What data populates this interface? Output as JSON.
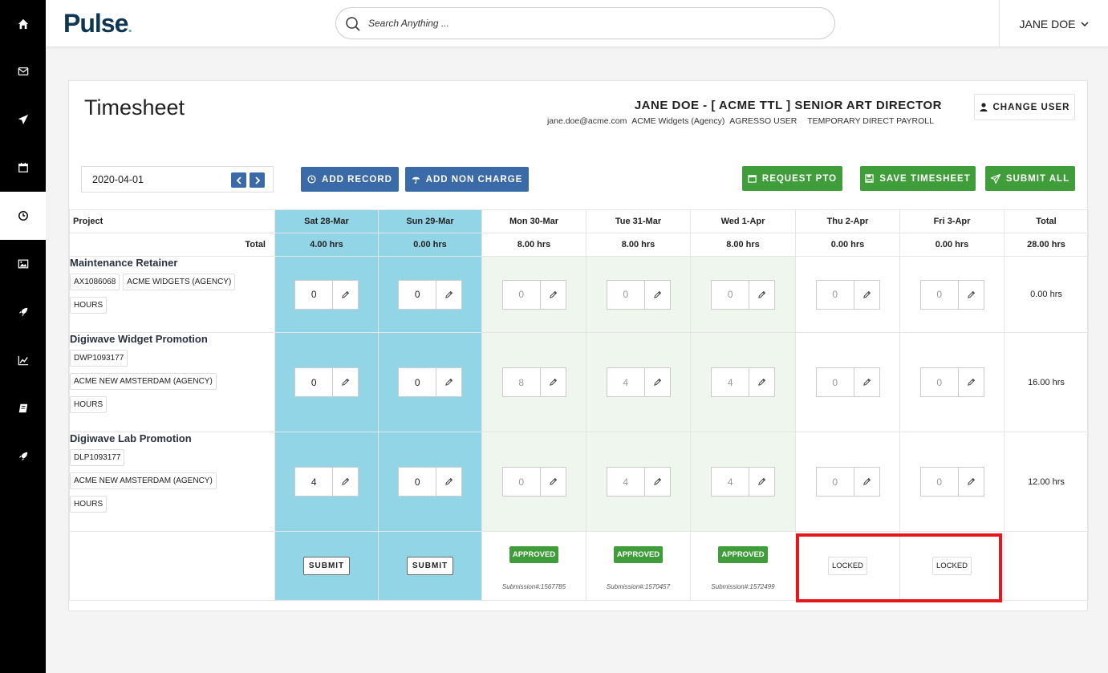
{
  "app": {
    "logo": "Pulse",
    "logo_dot": "."
  },
  "sidebar": {
    "items": [
      "home-icon",
      "mail-icon",
      "paper-plane-icon",
      "calendar-icon",
      "clock-icon",
      "image-icon",
      "rocket-icon",
      "chart-line-icon",
      "book-icon",
      "rocket-icon"
    ],
    "active_index": 4
  },
  "search": {
    "placeholder": "Search Anything ..."
  },
  "header": {
    "user_menu": "JANE DOE"
  },
  "page": {
    "title": "Timesheet",
    "user_title": "JANE DOE - [ ACME TTL ] SENIOR ART DIRECTOR",
    "user_email": "jane.doe@acme.com",
    "user_org": "ACME Widgets (Agency)",
    "user_role": "AGRESSO USER",
    "user_payroll": "TEMPORARY DIRECT PAYROLL",
    "change_user": "CHANGE USER",
    "date": "2020-04-01",
    "add_record": "ADD RECORD",
    "add_non_charge": "ADD NON CHARGE",
    "request_pto": "REQUEST PTO",
    "save_timesheet": "SAVE TIMESHEET",
    "submit_all": "SUBMIT ALL"
  },
  "grid": {
    "project_label": "Project",
    "total_label": "Total",
    "days": [
      {
        "label": "Sat 28-Mar",
        "total": "4.00 hrs"
      },
      {
        "label": "Sun 29-Mar",
        "total": "0.00 hrs"
      },
      {
        "label": "Mon 30-Mar",
        "total": "8.00 hrs"
      },
      {
        "label": "Tue 31-Mar",
        "total": "8.00 hrs"
      },
      {
        "label": "Wed 1-Apr",
        "total": "8.00 hrs"
      },
      {
        "label": "Thu 2-Apr",
        "total": "0.00 hrs"
      },
      {
        "label": "Fri 3-Apr",
        "total": "0.00 hrs"
      }
    ],
    "total_col": {
      "label": "Total",
      "total": "28.00 hrs"
    },
    "rows": [
      {
        "name": "Maintenance Retainer",
        "tags": [
          "AX1086068",
          "ACME WIDGETS (AGENCY)",
          "HOURS"
        ],
        "values": [
          "0",
          "0",
          "0",
          "0",
          "0",
          "0",
          "0"
        ],
        "total": "0.00 hrs"
      },
      {
        "name": "Digiwave Widget Promotion",
        "tags": [
          "DWP1093177",
          "ACME NEW AMSTERDAM (AGENCY)",
          "HOURS"
        ],
        "values": [
          "0",
          "0",
          "8",
          "4",
          "4",
          "0",
          "0"
        ],
        "total": "16.00 hrs"
      },
      {
        "name": "Digiwave Lab Promotion",
        "tags": [
          "DLP1093177",
          "ACME NEW AMSTERDAM (AGENCY)",
          "HOURS"
        ],
        "values": [
          "4",
          "0",
          "0",
          "4",
          "4",
          "0",
          "0"
        ],
        "total": "12.00 hrs"
      }
    ],
    "footer": {
      "submit": "SUBMIT",
      "approved": "APPROVED",
      "locked": "LOCKED",
      "submissions": [
        "Submission#:1567785",
        "Submission#:1570457",
        "Submission#:1572499"
      ]
    }
  },
  "colors": {
    "sidebar": "#000000",
    "weekend": "#92d5e6",
    "approved_bg": "#eef6ee",
    "blue_btn": "#3a6aa8",
    "green_btn": "#3f9e3a",
    "highlight": "#e7161b"
  }
}
